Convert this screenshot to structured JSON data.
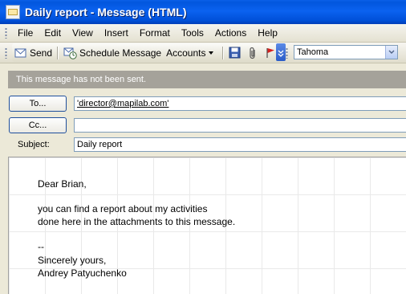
{
  "window": {
    "title": "Daily report - Message (HTML)"
  },
  "menu": [
    "File",
    "Edit",
    "View",
    "Insert",
    "Format",
    "Tools",
    "Actions",
    "Help"
  ],
  "toolbar": {
    "send_label": "Send",
    "schedule_label": "Schedule Message",
    "accounts_label": "Accounts",
    "font_value": "Tahoma"
  },
  "info_bar": "This message has not been sent.",
  "headers": {
    "to_button": "To...",
    "cc_button": "Cc...",
    "subject_label": "Subject:",
    "to_value": "'director@mapilab.com'",
    "cc_value": "",
    "subject_value": "Daily report"
  },
  "body": {
    "lines": [
      "Dear Brian,",
      "you can find a report about my activities",
      "done here in the attachments to this message.",
      "--",
      "Sincerely yours,",
      "Andrey Patyuchenko"
    ]
  }
}
